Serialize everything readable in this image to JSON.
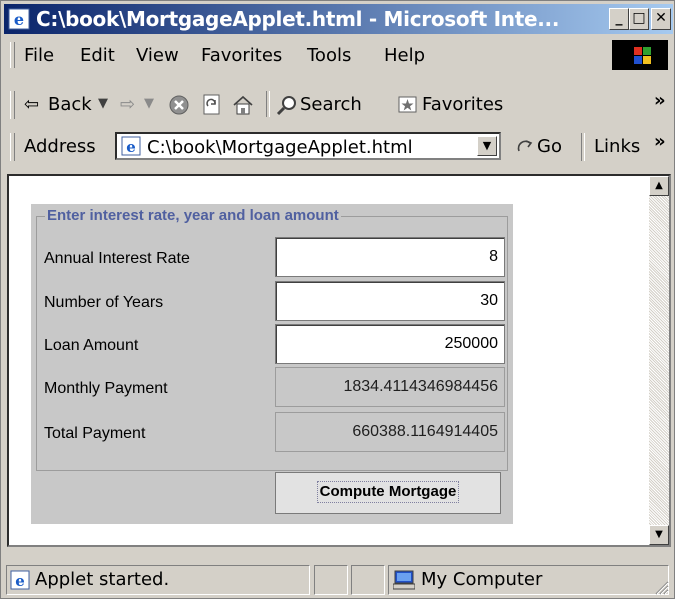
{
  "window": {
    "title": "C:\\book\\MortgageApplet.html - Microsoft Inte...",
    "min_label": "_",
    "max_label": "□",
    "close_label": "✕"
  },
  "menu": {
    "items": [
      "File",
      "Edit",
      "View",
      "Favorites",
      "Tools",
      "Help"
    ]
  },
  "toolbar": {
    "back_label": "Back",
    "search_label": "Search",
    "favorites_label": "Favorites",
    "more": "»"
  },
  "address": {
    "label": "Address",
    "value": "C:\\book\\MortgageApplet.html",
    "go_label": "Go",
    "links_label": "Links",
    "more": "»"
  },
  "applet": {
    "legend": "Enter interest rate, year and loan amount",
    "fields": [
      {
        "label": "Annual Interest Rate",
        "value": "8"
      },
      {
        "label": "Number of Years",
        "value": "30"
      },
      {
        "label": "Loan Amount",
        "value": "250000"
      },
      {
        "label": "Monthly Payment",
        "value": "1834.4114346984456"
      },
      {
        "label": "Total Payment",
        "value": "660388.1164914405"
      }
    ],
    "button_label": "Compute Mortgage"
  },
  "status": {
    "text": "Applet started.",
    "zone": "My Computer"
  },
  "colors": {
    "titlebar_start": "#0a246a",
    "titlebar_end": "#a6caf0",
    "chrome": "#d4d0c8",
    "applet_bg": "#c8c8c8",
    "legend_text": "#5060a0"
  }
}
